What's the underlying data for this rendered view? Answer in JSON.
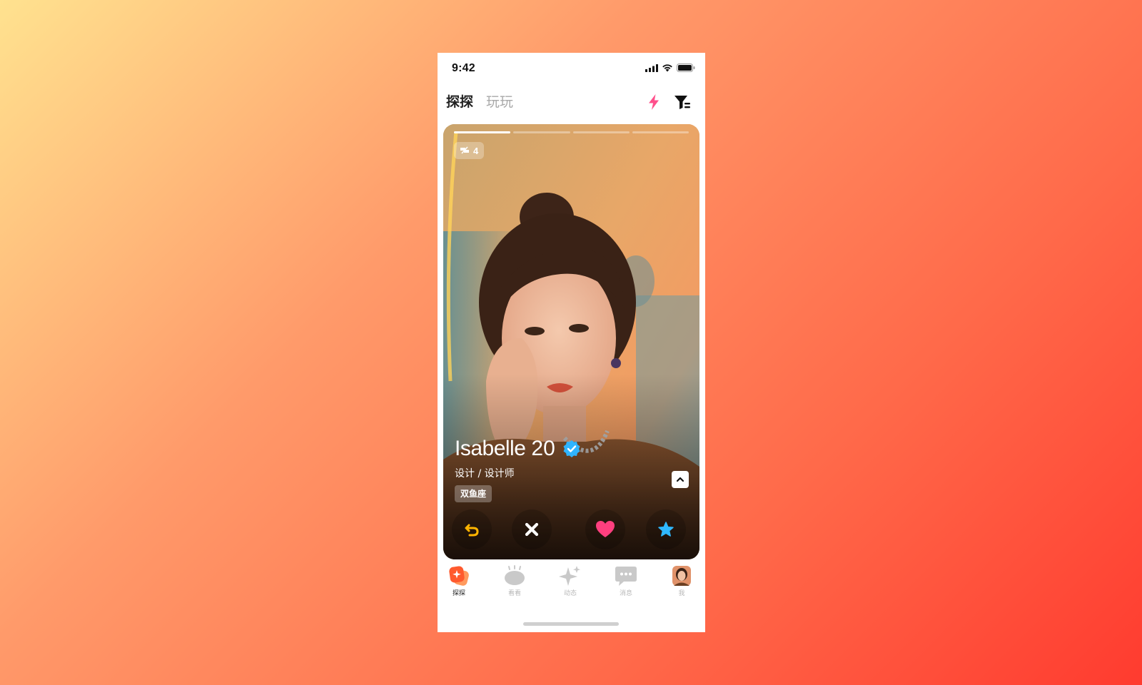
{
  "status_bar": {
    "time": "9:42",
    "icons": [
      "signal-icon",
      "wifi-icon",
      "battery-icon"
    ]
  },
  "header": {
    "tabs": [
      {
        "label": "探探",
        "active": true
      },
      {
        "label": "玩玩",
        "active": false
      }
    ],
    "boost_icon": "lightning-icon",
    "filter_icon": "filter-icon"
  },
  "card": {
    "photo_progress": {
      "total": 4,
      "current": 1
    },
    "photo_count": "4",
    "name": "Isabelle",
    "age": "20",
    "verified": true,
    "occupation": "设计 / 设计师",
    "tags": [
      "双鱼座"
    ],
    "actions": [
      {
        "name": "rewind",
        "icon": "undo-icon",
        "color": "#ffb400"
      },
      {
        "name": "nope",
        "icon": "close-icon",
        "color": "#ffffff"
      },
      {
        "name": "like",
        "icon": "heart-icon",
        "color": "#ff3f7f"
      },
      {
        "name": "super-like",
        "icon": "star-icon",
        "color": "#2fb8ff"
      }
    ]
  },
  "tabbar": {
    "items": [
      {
        "label": "探探",
        "icon": "tantan-icon",
        "active": true
      },
      {
        "label": "看看",
        "icon": "eye-icon",
        "active": false
      },
      {
        "label": "动态",
        "icon": "sparkle-icon",
        "active": false
      },
      {
        "label": "消息",
        "icon": "chat-icon",
        "active": false
      },
      {
        "label": "我",
        "icon": "avatar",
        "active": false
      }
    ]
  },
  "colors": {
    "accent": "#ff4f8b",
    "brand_orange": "#ff6a3a",
    "verified": "#2fb4ff"
  }
}
